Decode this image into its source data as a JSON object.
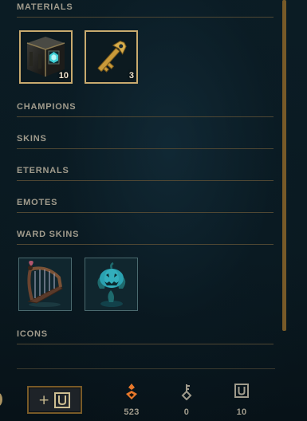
{
  "sections": [
    {
      "label": "MATERIALS"
    },
    {
      "label": "CHAMPIONS"
    },
    {
      "label": "SKINS"
    },
    {
      "label": "ETERNALS"
    },
    {
      "label": "EMOTES"
    },
    {
      "label": "WARD SKINS"
    },
    {
      "label": "ICONS"
    }
  ],
  "materials": [
    {
      "name": "hextech-chest",
      "count": "10",
      "icon": "hextech-chest-icon"
    },
    {
      "name": "hextech-key",
      "count": "3",
      "icon": "key-icon"
    }
  ],
  "ward_skins": [
    {
      "name": "harp-ward",
      "icon": "harp-ward-icon"
    },
    {
      "name": "pumpkin-ward",
      "icon": "pumpkin-ward-icon"
    }
  ],
  "footer": {
    "craft_button_plus": "+",
    "currencies": [
      {
        "name": "orange-essence",
        "value": "523",
        "icon": "orange-essence-icon",
        "color": "#e8782b"
      },
      {
        "name": "key-fragments",
        "value": "0",
        "icon": "key-fragment-icon",
        "color": "#a09b8c"
      },
      {
        "name": "chests",
        "value": "10",
        "icon": "chest-icon",
        "color": "#a09b8c"
      }
    ]
  },
  "colors": {
    "gold": "#c8aa6e",
    "gold_dark": "#785a28",
    "text": "#a09b8c",
    "divider": "#4f4733",
    "background": "#0a1920"
  }
}
